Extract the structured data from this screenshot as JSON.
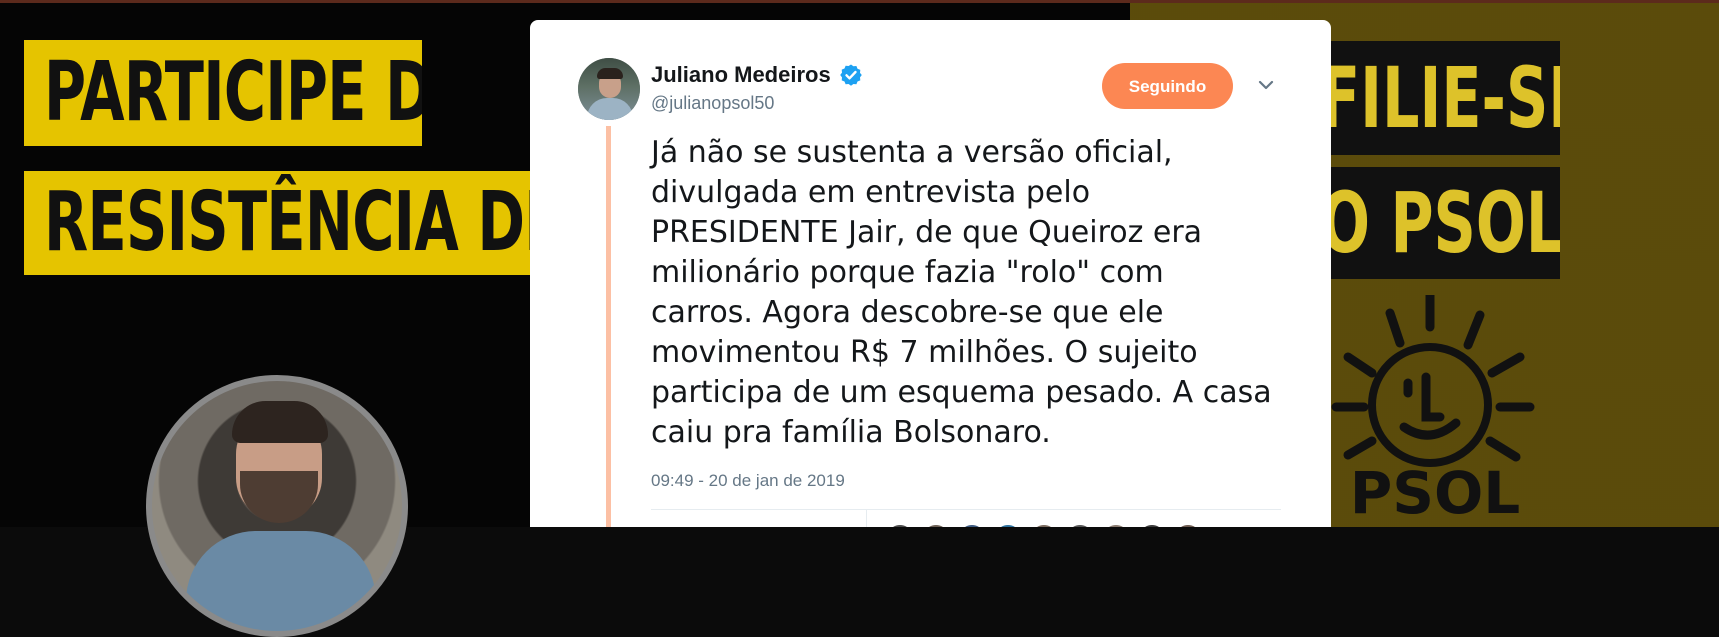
{
  "background": {
    "left_banner_lines": [
      "PARTICIPE DA",
      "RESISTÊNCIA DEMO"
    ],
    "right_banner_lines": [
      "FILIE-SE",
      "O PSOL!"
    ],
    "logo_text": "PSOL"
  },
  "tweet": {
    "author": {
      "display_name": "Juliano Medeiros",
      "handle": "@julianopsol50",
      "verified": true
    },
    "follow_button_label": "Seguindo",
    "text": "Já não se sustenta a versão oficial,\ndivulgada em entrevista pelo\nPRESIDENTE Jair, de que Queiroz era\nmilionário porque fazia \"rolo\" com\ncarros. Agora descobre-se que ele\nmovimentou R$ 7 milhões. O sujeito\nparticipa de um esquema pesado. A casa\ncaiu pra família Bolsonaro.",
    "timestamp": "09:49 - 20 de jan de 2019"
  },
  "colors": {
    "accent": "#fc8753",
    "thread_line": "#fcc0a4",
    "verified": "#1da1f2",
    "banner_yellow": "#e5c400"
  },
  "icons": {
    "verified": "verified-badge-icon",
    "menu": "chevron-down-icon"
  }
}
